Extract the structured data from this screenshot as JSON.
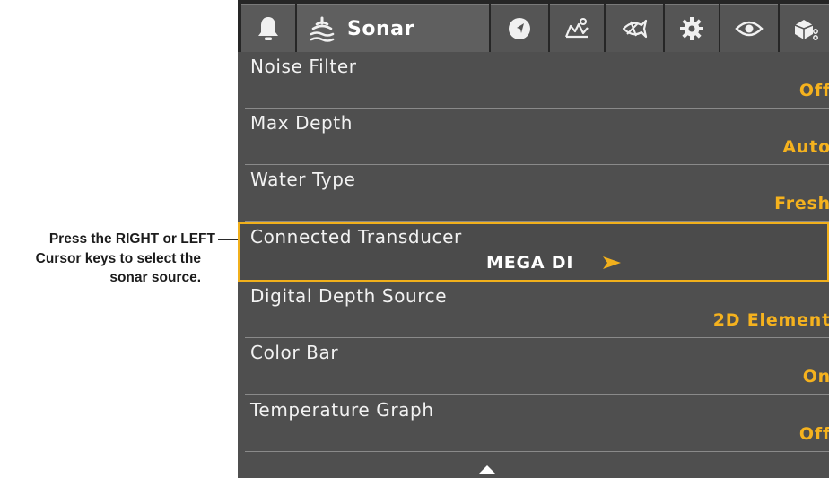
{
  "callout": {
    "line1": "Press the RIGHT or LEFT",
    "line2": "Cursor keys to select the",
    "line3": "sonar source."
  },
  "tabs": {
    "active_label": "Sonar",
    "icons": [
      "alarm-bell-icon",
      "sonar-waves-icon",
      "navigation-compass-icon",
      "chart-map-icon",
      "fish-finder-icon",
      "settings-gear-icon",
      "views-eye-icon",
      "accessories-icon"
    ]
  },
  "menu": {
    "items": [
      {
        "label": "Noise Filter",
        "value": "Off"
      },
      {
        "label": "Max Depth",
        "value": "Auto"
      },
      {
        "label": "Water Type",
        "value": "Fresh"
      },
      {
        "label": "Connected Transducer",
        "value": "MEGA DI"
      },
      {
        "label": "Digital Depth Source",
        "value": "2D Element"
      },
      {
        "label": "Color Bar",
        "value": "On"
      },
      {
        "label": "Temperature Graph",
        "value": "Off"
      }
    ]
  },
  "colors": {
    "accent": "#f1b01c",
    "value_text": "#f5b21e",
    "panel_bg": "#4f4f4f",
    "tab_bar_bg": "#262626"
  }
}
